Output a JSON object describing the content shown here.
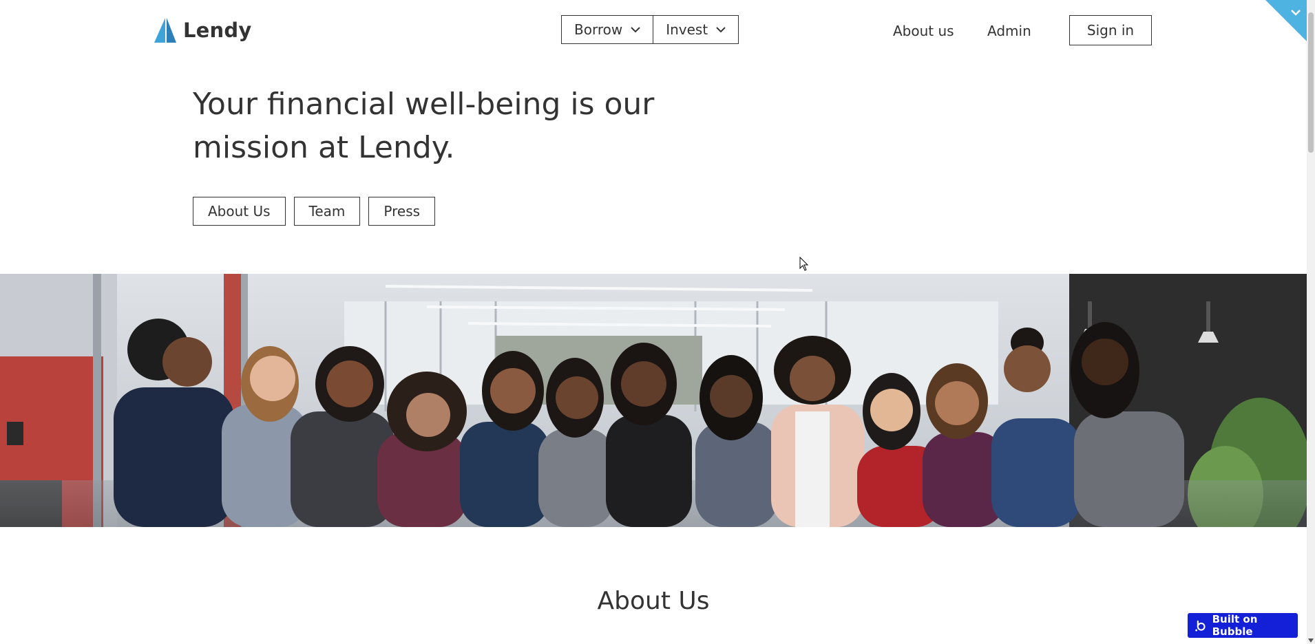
{
  "header": {
    "brand": "Lendy",
    "nav_dropdowns": [
      {
        "label": "Borrow"
      },
      {
        "label": "Invest"
      }
    ],
    "links": [
      {
        "label": "About us"
      },
      {
        "label": "Admin"
      }
    ],
    "signin_label": "Sign in"
  },
  "hero": {
    "title": "Your financial well-being is our mission at Lendy.",
    "tabs": [
      "About Us",
      "Team",
      "Press"
    ]
  },
  "section": {
    "title": "About Us"
  },
  "badge": {
    "label": "Built on Bubble"
  },
  "colors": {
    "brand_blue": "#3ea3d9",
    "corner_blue": "#4fb3e2",
    "badge_blue": "#1320d8",
    "text": "#333333"
  }
}
